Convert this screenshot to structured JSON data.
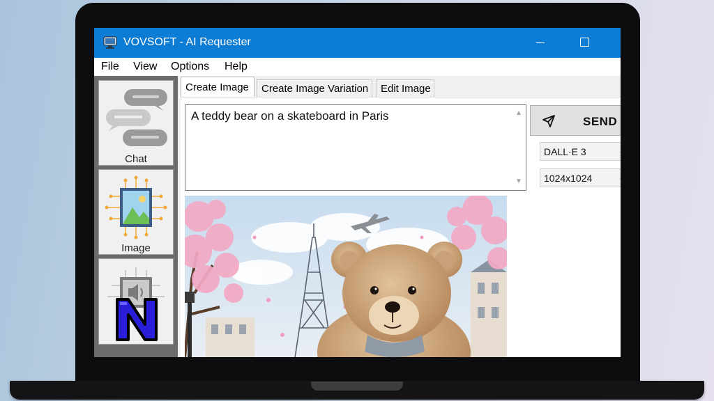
{
  "window": {
    "title": "VOVSOFT - AI Requester"
  },
  "menu": [
    "File",
    "View",
    "Options",
    "Help"
  ],
  "sidebar": {
    "items": [
      {
        "label": "Chat"
      },
      {
        "label": "Image"
      }
    ]
  },
  "tabs": [
    {
      "label": "Create Image",
      "active": true
    },
    {
      "label": "Create Image Variation",
      "active": false
    },
    {
      "label": "Edit Image",
      "active": false
    }
  ],
  "prompt": {
    "value": "A teddy bear on a skateboard in Paris"
  },
  "send": {
    "label": "SEND"
  },
  "model_select": {
    "value": "DALL·E 3"
  },
  "size_select": {
    "value": "1024x1024"
  },
  "colors": {
    "titlebar": "#0c7cd5",
    "sidebar": "#6b6b6b",
    "logo": "#2a1fd8"
  }
}
